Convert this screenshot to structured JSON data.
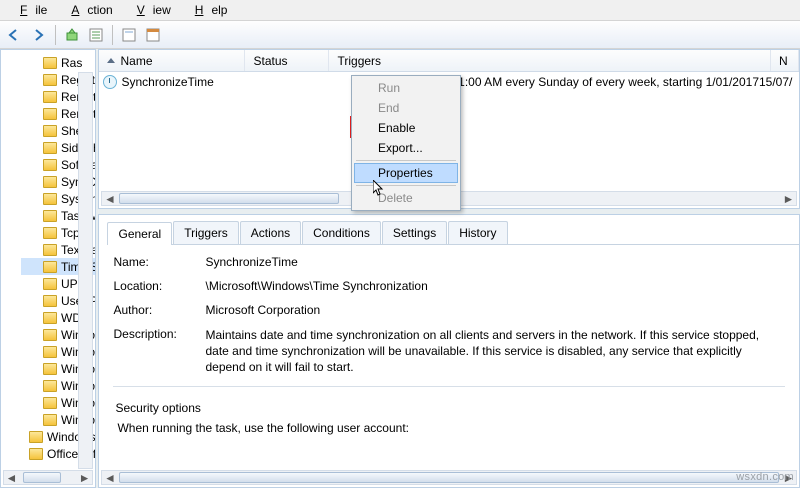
{
  "menu": {
    "file": "File",
    "action": "Action",
    "view": "View",
    "help": "Help"
  },
  "tree": {
    "items": [
      "Ras",
      "Registry",
      "RemoteApp and D",
      "RemoteAssistance",
      "Shell",
      "SideShow",
      "SoftwareProtecti",
      "SyncCenter",
      "SystemRestore",
      "Task Manager",
      "Tcpip",
      "TextServicesFram",
      "Time Synchroniza",
      "UPnP",
      "User Profile Servi",
      "WDI",
      "Windows Activati",
      "Windows Error Re",
      "Windows Filtering",
      "Windows Media S",
      "WindowsBackup",
      "WindowsColorSys"
    ],
    "level2a": "Windows Defender",
    "level2b": "OfficeSoftwareProtection",
    "selected_index": 12
  },
  "list": {
    "headers": {
      "name": "Name",
      "status": "Status",
      "triggers": "Triggers",
      "next": "N"
    },
    "row": {
      "name": "SynchronizeTime",
      "status": "",
      "triggers": "At 1:00 AM every Sunday of every week, starting 1/01/2017",
      "next": "15/07/"
    }
  },
  "context_menu": {
    "run": "Run",
    "end": "End",
    "enable": "Enable",
    "export": "Export...",
    "properties": "Properties",
    "delete": "Delete"
  },
  "tabs": {
    "general": "General",
    "triggers": "Triggers",
    "actions": "Actions",
    "conditions": "Conditions",
    "settings": "Settings",
    "history": "History"
  },
  "detail": {
    "name_lbl": "Name:",
    "name_val": "SynchronizeTime",
    "loc_lbl": "Location:",
    "loc_val": "\\Microsoft\\Windows\\Time Synchronization",
    "author_lbl": "Author:",
    "author_val": "Microsoft Corporation",
    "desc_lbl": "Description:",
    "desc_val": "Maintains date and time synchronization on all clients and servers in the network. If this service stopped, date and time synchronization will be unavailable. If this service is disabled, any service that explicitly depend on it will fail to start.",
    "sec_lbl": "Security options",
    "user_lbl": "When running the task, use the following user account:"
  },
  "watermark": "wsxdn.com"
}
